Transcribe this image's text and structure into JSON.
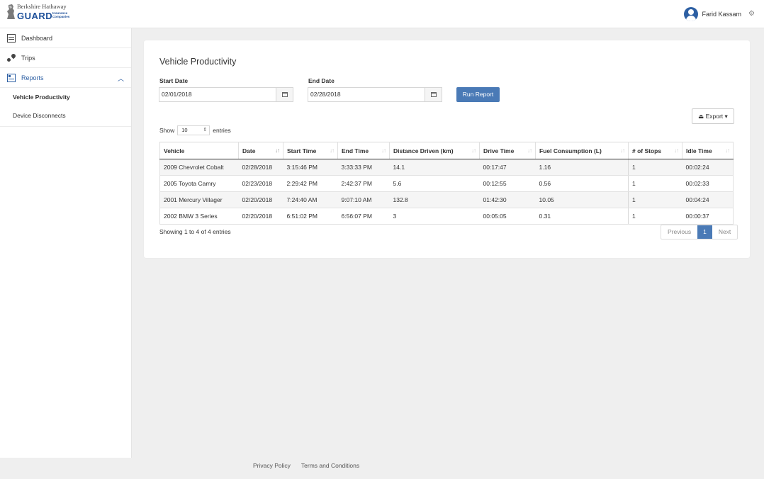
{
  "brand": {
    "line1": "Berkshire Hathaway",
    "guard": "GUARD",
    "small": "Insurance Companies",
    "colors": {
      "brand_blue": "#1d4f99",
      "accent": "#4a7ab6"
    }
  },
  "user": {
    "name": "Farid Kassam",
    "avatar_icon": "user-avatar-icon",
    "settings_icon": "gear-icon"
  },
  "sidebar": {
    "items": [
      {
        "label": "Dashboard",
        "icon": "dashboard-icon"
      },
      {
        "label": "Trips",
        "icon": "trips-icon"
      },
      {
        "label": "Reports",
        "icon": "reports-icon",
        "expanded": true
      }
    ],
    "sub_items": [
      {
        "label": "Vehicle Productivity",
        "current": true
      },
      {
        "label": "Device Disconnects",
        "current": false
      }
    ]
  },
  "report": {
    "title": "Vehicle Productivity",
    "start_label": "Start Date",
    "start_value": "02/01/2018",
    "end_label": "End Date",
    "end_value": "02/28/2018",
    "run_label": "Run Report",
    "export_label": "Export",
    "show_label": "Show",
    "show_value": "10",
    "entries_label": "entries",
    "columns": [
      "Vehicle",
      "Date",
      "Start Time",
      "End Time",
      "Distance Driven (km)",
      "Drive Time",
      "Fuel Consumption (L)",
      "# of Stops",
      "Idle Time"
    ],
    "rows": [
      [
        "2009 Chevrolet Cobalt",
        "02/28/2018",
        "3:15:46 PM",
        "3:33:33 PM",
        "14.1",
        "00:17:47",
        "1.16",
        "1",
        "00:02:24"
      ],
      [
        "2005 Toyota Camry",
        "02/23/2018",
        "2:29:42 PM",
        "2:42:37 PM",
        "5.6",
        "00:12:55",
        "0.56",
        "1",
        "00:02:33"
      ],
      [
        "2001 Mercury Villager",
        "02/20/2018",
        "7:24:40 AM",
        "9:07:10 AM",
        "132.8",
        "01:42:30",
        "10.05",
        "1",
        "00:04:24"
      ],
      [
        "2002 BMW 3 Series",
        "02/20/2018",
        "6:51:02 PM",
        "6:56:07 PM",
        "3",
        "00:05:05",
        "0.31",
        "1",
        "00:00:37"
      ]
    ],
    "info": "Showing 1 to 4 of 4 entries",
    "pagination": {
      "previous": "Previous",
      "current": "1",
      "next": "Next"
    }
  },
  "footer": {
    "privacy": "Privacy Policy",
    "terms": "Terms and Conditions"
  }
}
